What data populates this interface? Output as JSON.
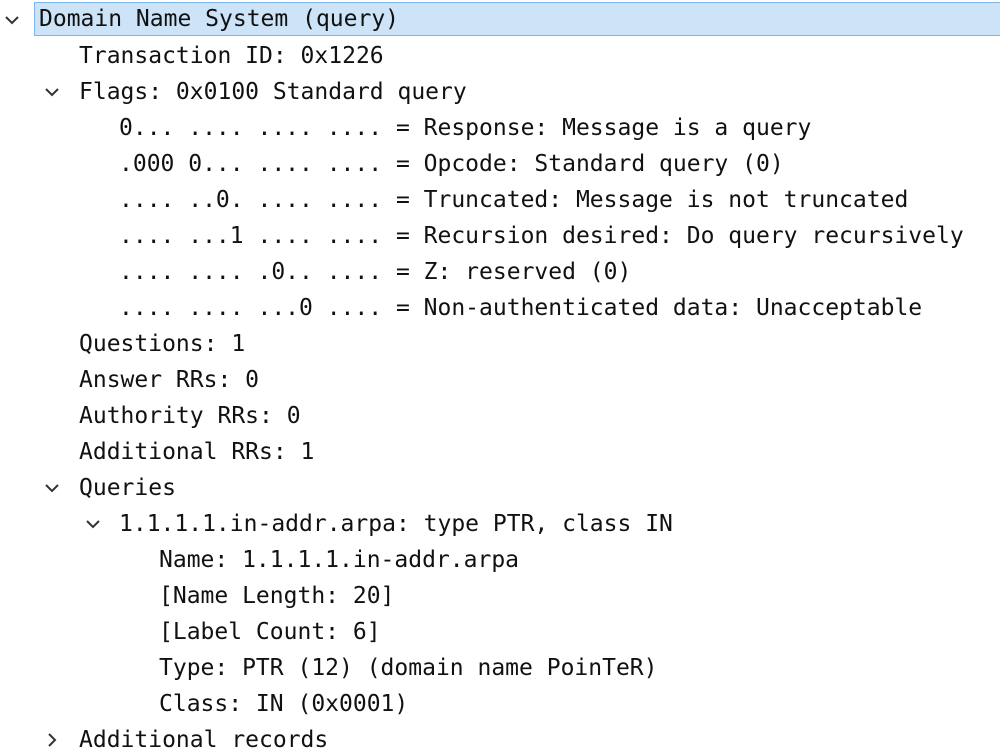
{
  "tree": {
    "root": {
      "label": "Domain Name System (query)",
      "expanded": true
    },
    "transaction_id": "Transaction ID: 0x1226",
    "flags": {
      "label": "Flags: 0x0100 Standard query",
      "expanded": true,
      "items": [
        "0... .... .... .... = Response: Message is a query",
        ".000 0... .... .... = Opcode: Standard query (0)",
        ".... ..0. .... .... = Truncated: Message is not truncated",
        ".... ...1 .... .... = Recursion desired: Do query recursively",
        ".... .... .0.. .... = Z: reserved (0)",
        ".... .... ...0 .... = Non-authenticated data: Unacceptable"
      ]
    },
    "questions": "Questions: 1",
    "answer_rrs": "Answer RRs: 0",
    "authority_rrs": "Authority RRs: 0",
    "additional_rrs": "Additional RRs: 1",
    "queries": {
      "label": "Queries",
      "expanded": true,
      "entry": {
        "label": "1.1.1.1.in-addr.arpa: type PTR, class IN",
        "expanded": true,
        "fields": [
          "Name: 1.1.1.1.in-addr.arpa",
          "[Name Length: 20]",
          "[Label Count: 6]",
          "Type: PTR (12) (domain name PoinTeR)",
          "Class: IN (0x0001)"
        ]
      }
    },
    "additional_records": {
      "label": "Additional records",
      "expanded": false
    }
  }
}
